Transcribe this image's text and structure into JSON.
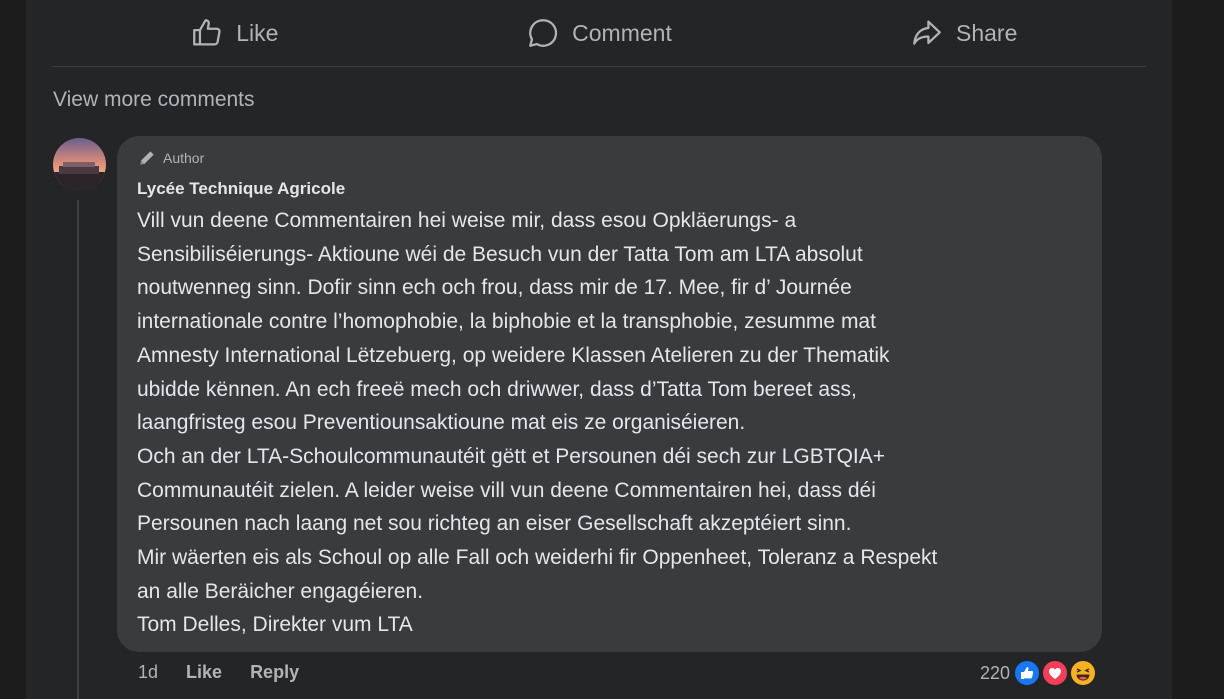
{
  "actions": {
    "like_label": "Like",
    "comment_label": "Comment",
    "share_label": "Share"
  },
  "view_more_label": "View more comments",
  "comment": {
    "badge_label": "Author",
    "author_name": "Lycée Technique Agricole",
    "lines": [
      "Vill vun deene Commentairen hei weise mir, dass esou Opkläerungs- a",
      "Sensibiliséierungs- Aktioune wéi de Besuch vun der Tatta Tom am LTA absolut",
      "noutwenneg sinn. Dofir sinn ech och frou, dass mir de 17. Mee, fir d’ Journée",
      "internationale contre l’homophobie, la biphobie et la transphobie, zesumme mat",
      "Amnesty International Lëtzebuerg, op weidere Klassen Atelieren zu der Thematik",
      "ubidde kënnen. An ech freeë mech och driwwer, dass d’Tatta Tom bereet ass,",
      "laangfristeg esou Preventiounsaktioune mat eis ze organiséieren.",
      "Och an der LTA-Schoulcommunautéit gëtt et Persounen déi sech zur LGBTQIA+",
      "Communautéit zielen. A leider weise vill vun deene Commentairen hei, dass déi",
      "Persounen nach laang net sou richteg an eiser Gesellschaft akzeptéiert sinn.",
      "Mir wäerten eis als Schoul op alle Fall och weiderhi fir Oppenheet, Toleranz a Respekt",
      "an alle Beräicher engagéieren.",
      "Tom Delles, Direkter vum LTA"
    ],
    "time": "1d",
    "like_label": "Like",
    "reply_label": "Reply",
    "reaction_count": "220",
    "reaction_icons": [
      "like-reaction-icon",
      "love-reaction-icon",
      "haha-reaction-icon"
    ]
  },
  "colors": {
    "background": "#1c1c1d",
    "panel": "#242526",
    "bubble": "#3a3b3c",
    "text_primary": "#e4e6eb",
    "text_secondary": "#b0b3b8",
    "like_blue": "#1877f2",
    "love_red": "#f33e58",
    "haha_yellow": "#f7b125"
  }
}
